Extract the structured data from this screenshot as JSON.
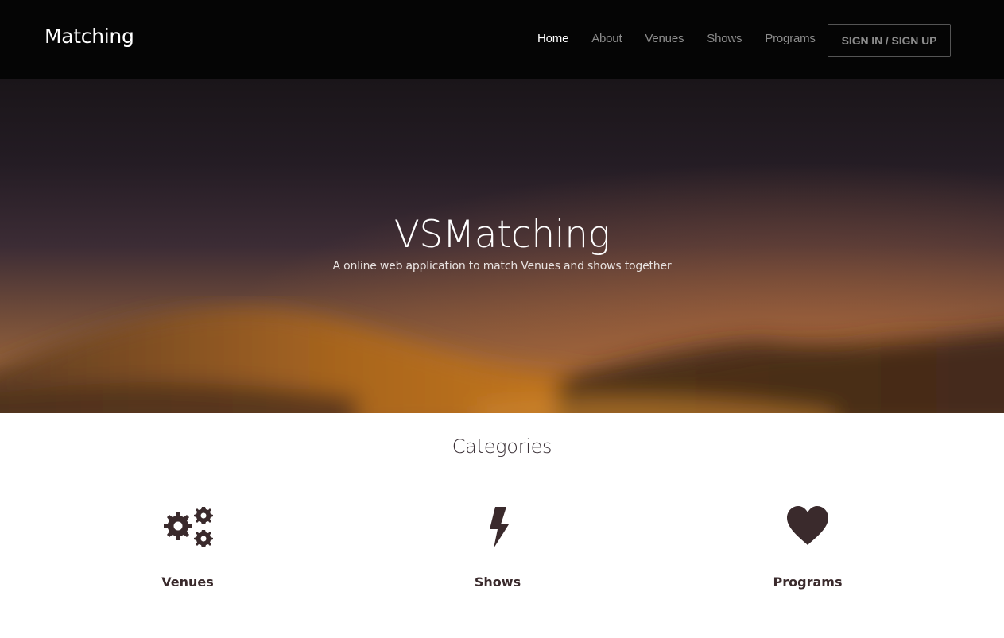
{
  "navbar": {
    "brand": "Matching",
    "links": [
      {
        "label": "Home",
        "active": true
      },
      {
        "label": "About",
        "active": false
      },
      {
        "label": "Venues",
        "active": false
      },
      {
        "label": "Shows",
        "active": false
      },
      {
        "label": "Programs",
        "active": false
      }
    ],
    "signin_label": "SIGN IN / SIGN UP"
  },
  "hero": {
    "title": "VSMatching",
    "subtitle": "A online web application to match Venues and shows together"
  },
  "categories": {
    "heading": "Categories",
    "items": [
      {
        "label": "Venues",
        "icon": "gears-icon"
      },
      {
        "label": "Shows",
        "icon": "lightning-bolt-icon"
      },
      {
        "label": "Programs",
        "icon": "heart-icon"
      }
    ]
  },
  "colors": {
    "navbar_bg": "#050505",
    "nav_active": "#ffffff",
    "nav_inactive": "#8c8c8c",
    "icon_color": "#3a2a2c"
  }
}
